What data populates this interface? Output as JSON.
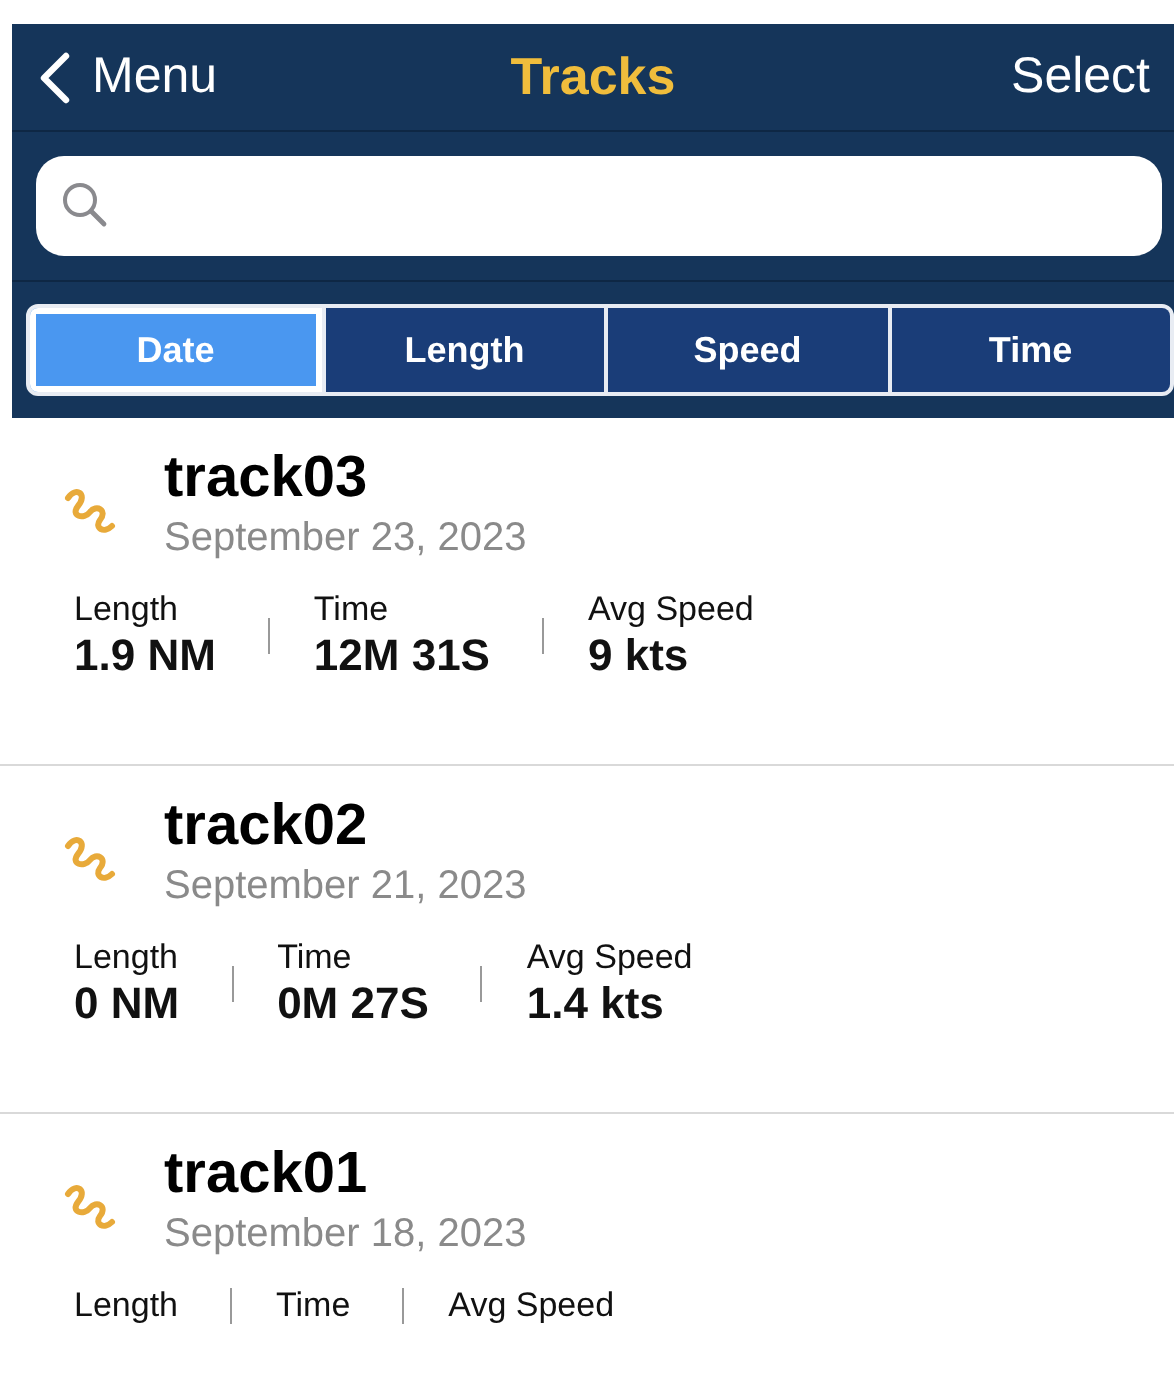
{
  "nav": {
    "back": "Menu",
    "title": "Tracks",
    "action": "Select"
  },
  "sort_tabs": [
    {
      "label": "Date",
      "selected": true
    },
    {
      "label": "Length",
      "selected": false
    },
    {
      "label": "Speed",
      "selected": false
    },
    {
      "label": "Time",
      "selected": false
    }
  ],
  "tracks": [
    {
      "name": "track03",
      "date": "September 23, 2023",
      "stats": [
        {
          "label": "Length",
          "value": "1.9 NM"
        },
        {
          "label": "Time",
          "value": "12M 31S"
        },
        {
          "label": "Avg Speed",
          "value": "9 kts"
        }
      ]
    },
    {
      "name": "track02",
      "date": "September 21, 2023",
      "stats": [
        {
          "label": "Length",
          "value": "0 NM"
        },
        {
          "label": "Time",
          "value": "0M 27S"
        },
        {
          "label": "Avg Speed",
          "value": "1.4 kts"
        }
      ]
    },
    {
      "name": "track01",
      "date": "September 18, 2023",
      "stats": [
        {
          "label": "Length"
        },
        {
          "label": "Time"
        },
        {
          "label": "Avg Speed"
        }
      ]
    }
  ]
}
